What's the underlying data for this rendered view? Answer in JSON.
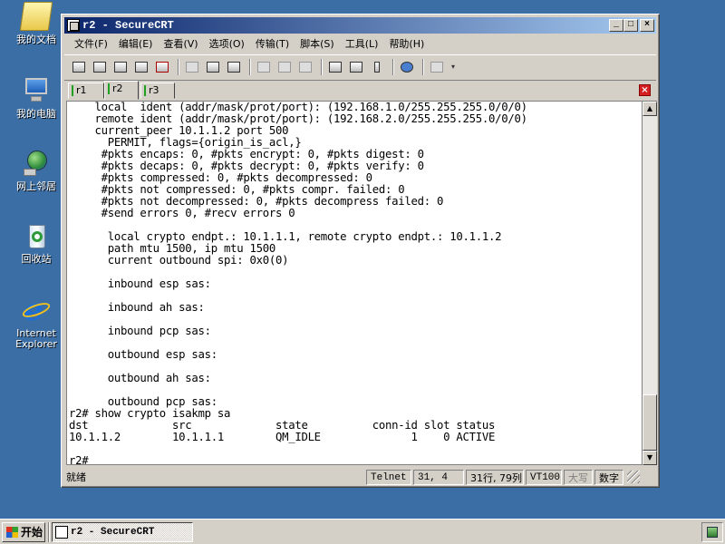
{
  "desktop": {
    "icons": [
      {
        "label": "我的文档"
      },
      {
        "label": "我的电脑"
      },
      {
        "label": "网上邻居"
      },
      {
        "label": "回收站"
      },
      {
        "label": "Internet Explorer"
      }
    ]
  },
  "window": {
    "title": "r2 - SecureCRT",
    "buttons": {
      "minimize": "_",
      "maximize": "□",
      "close": "×"
    },
    "menu": [
      "文件(F)",
      "编辑(E)",
      "查看(V)",
      "选项(O)",
      "传输(T)",
      "脚本(S)",
      "工具(L)",
      "帮助(H)"
    ],
    "tabs": [
      {
        "label": "r1",
        "active": false
      },
      {
        "label": "r2",
        "active": true
      },
      {
        "label": "r3",
        "active": false
      }
    ],
    "tab_close": "×",
    "terminal_lines": [
      "    local  ident (addr/mask/prot/port): (192.168.1.0/255.255.255.0/0/0)",
      "    remote ident (addr/mask/prot/port): (192.168.2.0/255.255.255.0/0/0)",
      "    current_peer 10.1.1.2 port 500",
      "      PERMIT, flags={origin_is_acl,}",
      "     #pkts encaps: 0, #pkts encrypt: 0, #pkts digest: 0",
      "     #pkts decaps: 0, #pkts decrypt: 0, #pkts verify: 0",
      "     #pkts compressed: 0, #pkts decompressed: 0",
      "     #pkts not compressed: 0, #pkts compr. failed: 0",
      "     #pkts not decompressed: 0, #pkts decompress failed: 0",
      "     #send errors 0, #recv errors 0",
      "",
      "      local crypto endpt.: 10.1.1.1, remote crypto endpt.: 10.1.1.2",
      "      path mtu 1500, ip mtu 1500",
      "      current outbound spi: 0x0(0)",
      "",
      "      inbound esp sas:",
      "",
      "      inbound ah sas:",
      "",
      "      inbound pcp sas:",
      "",
      "      outbound esp sas:",
      "",
      "      outbound ah sas:",
      "",
      "      outbound pcp sas:",
      "r2# show crypto isakmp sa",
      "dst             src             state          conn-id slot status",
      "10.1.1.2        10.1.1.1        QM_IDLE              1    0 ACTIVE",
      "",
      "r2#"
    ],
    "status": {
      "ready": "就绪",
      "protocol": "Telnet",
      "cursor": "31,   4",
      "rowcol": "31行, 79列",
      "emulation": "VT100",
      "caps": "大写",
      "num": "数字"
    }
  },
  "taskbar": {
    "start": "开始",
    "task": "r2 - SecureCRT"
  }
}
